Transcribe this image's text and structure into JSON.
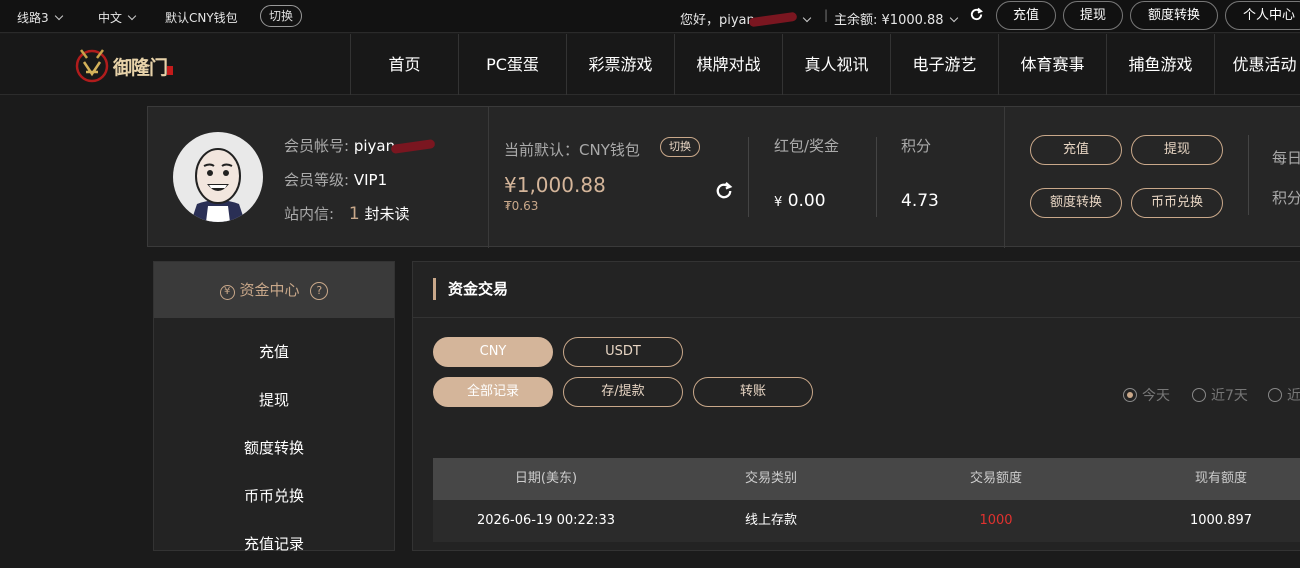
{
  "topbar": {
    "line_select": "线路3",
    "lang_select": "中文",
    "wallet_default": "默认CNY钱包",
    "switch_label": "切换",
    "greeting": "您好，piyan",
    "balance_label": "主余额:",
    "balance_value": "¥1000.88",
    "buttons": [
      "充值",
      "提现",
      "额度转换",
      "个人中心"
    ]
  },
  "nav": {
    "logo_text": "御隆门",
    "items": [
      "首页",
      "PC蛋蛋",
      "彩票游戏",
      "棋牌对战",
      "真人视讯",
      "电子游艺",
      "体育赛事",
      "捕鱼游戏",
      "优惠活动"
    ]
  },
  "member": {
    "account_label": "会员帐号:",
    "account_value": "piyan",
    "level_label": "会员等级:",
    "level_value": "VIP1",
    "mail_label": "站内信:",
    "mail_count": "1",
    "mail_unit": "封未读"
  },
  "wallet": {
    "current_label": "当前默认：CNY钱包",
    "switch_label": "切换",
    "amount": "¥1,000.88",
    "sub_amount": "₮0.63",
    "bonus_label": "红包/奖金",
    "bonus_value": "0.00",
    "bonus_symbol": "¥",
    "points_label": "积分",
    "points_value": "4.73"
  },
  "actions": [
    "充值",
    "提现",
    "额度转换",
    "币币兑换"
  ],
  "right_cut": {
    "daily": "每日",
    "points": "积分"
  },
  "sidebar": {
    "title": "资金中心",
    "help_icon": "?",
    "items": [
      "充值",
      "提现",
      "额度转换",
      "币币兑换",
      "充值记录"
    ]
  },
  "main": {
    "title": "资金交易",
    "currency_tabs": [
      "CNY",
      "USDT"
    ],
    "type_tabs": [
      "全部记录",
      "存/提款",
      "转账"
    ],
    "date_filters": [
      "今天",
      "近7天",
      "近"
    ],
    "table": {
      "headers": [
        "日期(美东)",
        "交易类别",
        "交易额度",
        "现有额度"
      ],
      "rows": [
        [
          "2026-06-19 00:22:33",
          "线上存款",
          "1000",
          "1000.897"
        ]
      ]
    }
  },
  "colors": {
    "accent": "#c9a88a",
    "accent_fill": "#d4b59a",
    "negative": "#e0322f"
  }
}
